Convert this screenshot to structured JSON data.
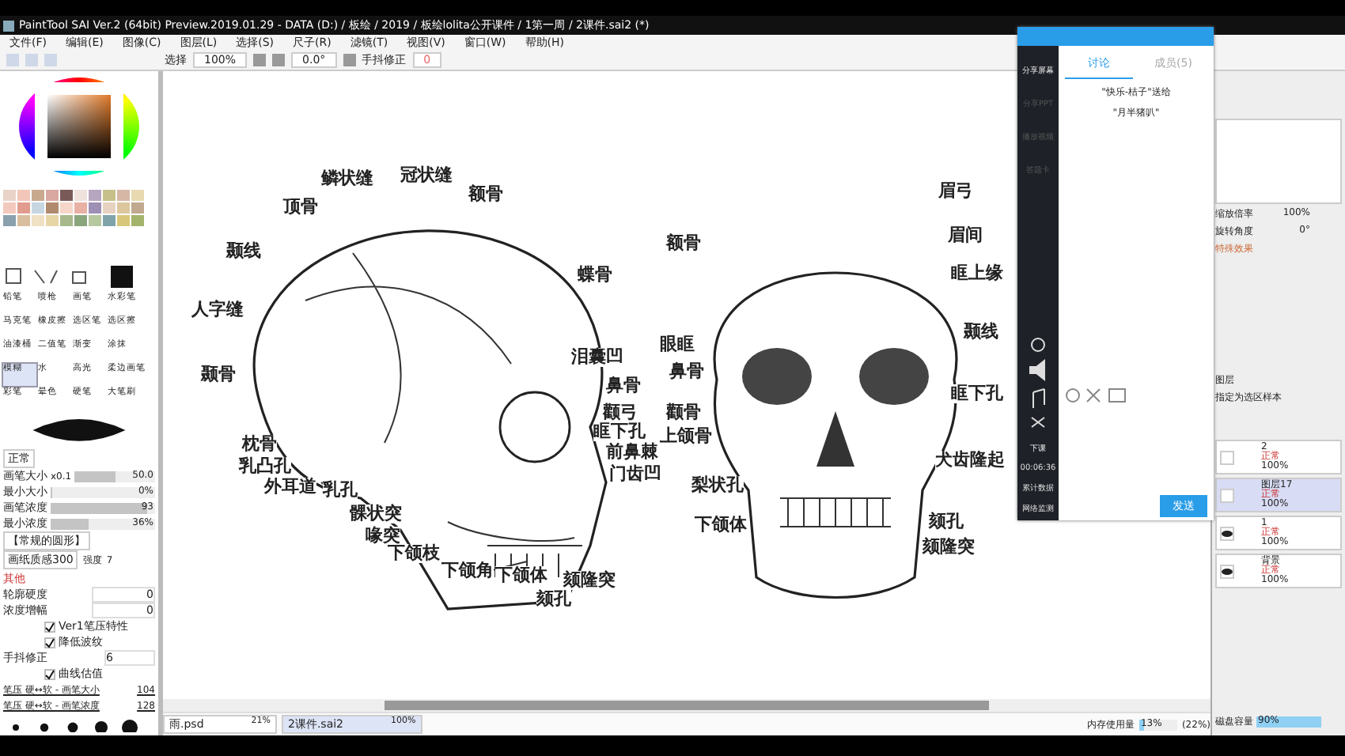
{
  "title_bar": {
    "title": "PaintTool SAI Ver.2 (64bit) Preview.2019.01.29 - DATA (D:) / 板绘 / 2019 / 板绘lolita公开课件 / 1第一周 / 2课件.sai2 (*)"
  },
  "menu": [
    "文件(F)",
    "编辑(E)",
    "图像(C)",
    "图层(L)",
    "选择(S)",
    "尺子(R)",
    "滤镜(T)",
    "视图(V)",
    "窗口(W)",
    "帮助(H)"
  ],
  "toolbar": {
    "select_label": "选择",
    "zoom": "100%",
    "angle": "0.0°",
    "stabilizer_label": "手抖修正",
    "stabilizer_value": "0"
  },
  "swatches": [
    {
      "color": "#e9d3c9"
    },
    {
      "color": "#f2c6b8"
    },
    {
      "color": "#c9a98e"
    },
    {
      "color": "#d9a8a0"
    },
    {
      "color": "#7a5a58"
    },
    {
      "color": "#efe2dd"
    },
    {
      "color": "#b7a6c0"
    },
    {
      "color": "#c7c08a"
    },
    {
      "color": "#d6b7a6"
    },
    {
      "color": "#e8d9b0"
    },
    {
      "color": "#f4c9bd"
    },
    {
      "color": "#e29c8e"
    },
    {
      "color": "#c6d7e2"
    },
    {
      "color": "#b08a6e"
    },
    {
      "color": "#f5d6c8"
    },
    {
      "color": "#e9b1a4"
    },
    {
      "color": "#9e8fb5"
    },
    {
      "color": "#e7d2c1"
    },
    {
      "color": "#dcc79c"
    },
    {
      "color": "#c1a98f"
    },
    {
      "color": "#8aa0ad"
    },
    {
      "color": "#d9bf9f"
    },
    {
      "color": "#f0e1c4"
    },
    {
      "color": "#e6d6a6"
    },
    {
      "color": "#a7b98c"
    },
    {
      "color": "#8aa47c"
    },
    {
      "color": "#b7c7a0"
    },
    {
      "color": "#7fa3a9"
    },
    {
      "color": "#d8c77a"
    },
    {
      "color": "#a4b46d"
    }
  ],
  "tools": [
    {
      "label": "铅笔",
      "selected": false
    },
    {
      "label": "喷枪",
      "selected": false
    },
    {
      "label": "画笔",
      "selected": false
    },
    {
      "label": "水彩笔",
      "selected": false
    },
    {
      "label": "马克笔",
      "selected": false
    },
    {
      "label": "橡皮擦",
      "selected": false
    },
    {
      "label": "选区笔",
      "selected": false
    },
    {
      "label": "选区擦",
      "selected": false
    },
    {
      "label": "油漆桶",
      "selected": false
    },
    {
      "label": "二值笔",
      "selected": false
    },
    {
      "label": "渐变",
      "selected": false
    },
    {
      "label": "涂抹",
      "selected": false
    },
    {
      "label": "模糊",
      "selected": true
    },
    {
      "label": "水",
      "selected": false
    },
    {
      "label": "高光",
      "selected": false
    },
    {
      "label": "柔边画笔",
      "selected": false
    },
    {
      "label": "彩笔",
      "selected": false
    },
    {
      "label": "晕色",
      "selected": false
    },
    {
      "label": "硬笔",
      "selected": false
    },
    {
      "label": "大笔刷",
      "selected": false
    }
  ],
  "brush": {
    "mode": "正常",
    "params": [
      {
        "label": "画笔大小",
        "prefix": "x0.1",
        "value": "50.0",
        "level": 0.5
      },
      {
        "label": "最小大小",
        "value": "0%",
        "level": 0
      },
      {
        "label": "画笔浓度",
        "value": "93",
        "level": 0.93
      },
      {
        "label": "最小浓度",
        "value": "36%",
        "level": 0.36
      }
    ],
    "shape": "【常规的圆形】",
    "texture": "画纸质感300",
    "strength_label": "强度",
    "strength": "7",
    "other_label": "其他",
    "fields": [
      {
        "label": "轮廓硬度",
        "value": "0"
      },
      {
        "label": "浓度增幅",
        "value": "0"
      }
    ],
    "checks": [
      {
        "label": "Ver1笔压特性",
        "checked": true
      },
      {
        "label": "降低波纹",
        "checked": true
      }
    ],
    "stabilizer_label": "手抖修正",
    "stabilizer": "6",
    "curve": {
      "label": "曲线估值",
      "checked": true
    },
    "pressure": [
      {
        "label": "笔压 硬↔软 - 画笔大小",
        "value": "104"
      },
      {
        "label": "笔压 硬↔软 - 画笔浓度",
        "value": "128"
      }
    ]
  },
  "canvas": {
    "labels": [
      "鳞状缝",
      "冠状缝",
      "额骨",
      "顶骨",
      "颞线",
      "人字缝",
      "蝶骨",
      "颞骨",
      "泪囊凹",
      "鼻骨",
      "颧弓",
      "眶下孔",
      "前鼻棘",
      "门齿凹",
      "枕骨",
      "乳凸孔",
      "外耳道",
      "乳孔",
      "髁状突",
      "喙突",
      "下颌枝",
      "下颌角",
      "下颌体",
      "颏隆突",
      "颏孔",
      "眉弓",
      "额骨",
      "眉间",
      "眶上缘",
      "颞线",
      "眼眶",
      "鼻骨",
      "眶下孔",
      "颧骨",
      "上颌骨",
      "犬齿隆起",
      "梨状孔",
      "下颌体",
      "颏孔",
      "颏隆突"
    ]
  },
  "classroom": {
    "sidebar": [
      "分享屏幕",
      "分享PPT",
      "播放视频",
      "答题卡"
    ],
    "end_label": "下课",
    "timer": "00:06:36",
    "stats": [
      "累计数据",
      "网络监测"
    ],
    "tabs": [
      {
        "label": "讨论",
        "selected": true
      },
      {
        "label": "成员(5)",
        "selected": false
      }
    ],
    "messages": [
      "\"快乐-桔子\"送给",
      "\"月半猪叭\""
    ],
    "send": "发送"
  },
  "navigator": {
    "zoom_label": "缩放倍率",
    "zoom": "100%",
    "angle_label": "旋转角度",
    "angle": "0°",
    "effects_label": "特殊效果"
  },
  "layer_panel": {
    "title": "图层",
    "sample_label": "指定为选区样本",
    "layers": [
      {
        "name": "2",
        "mode": "正常",
        "opacity": "100%",
        "visible": false,
        "selected": false
      },
      {
        "name": "图层17",
        "mode": "正常",
        "opacity": "100%",
        "visible": false,
        "selected": true
      },
      {
        "name": "1",
        "mode": "正常",
        "opacity": "100%",
        "visible": true,
        "selected": false
      },
      {
        "name": "背景",
        "mode": "正常",
        "opacity": "100%",
        "visible": true,
        "selected": false
      }
    ]
  },
  "documents": [
    {
      "name": "雨.psd",
      "zoom": "21%",
      "selected": false
    },
    {
      "name": "2课件.sai2",
      "zoom": "100%",
      "selected": true
    }
  ],
  "status": {
    "memory": {
      "label": "内存使用量",
      "value": "13%",
      "total": "(22%)",
      "level": 0.13
    },
    "disk": {
      "label": "磁盘容量",
      "value": "90%",
      "level": 0.9
    }
  }
}
